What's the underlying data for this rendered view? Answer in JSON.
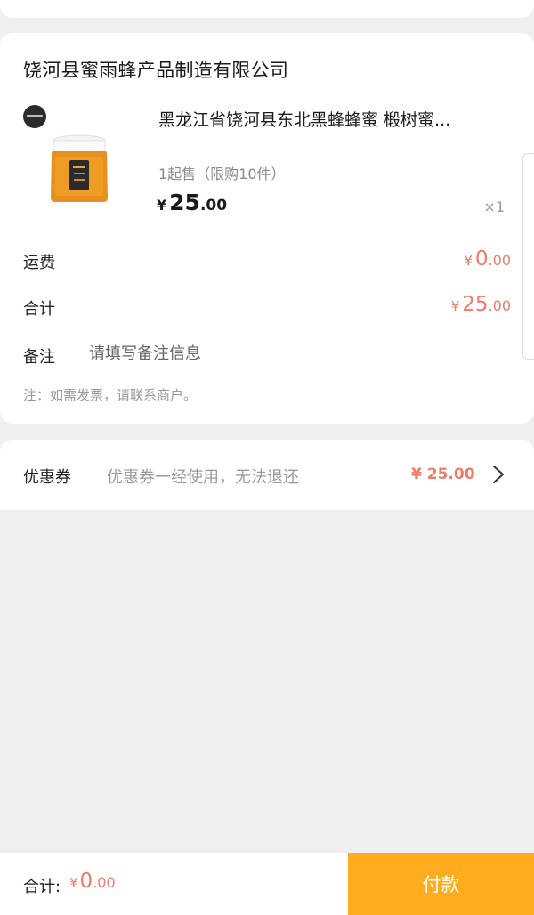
{
  "order": {
    "shop_name": "饶河县蜜雨蜂产品制造有限公司",
    "product": {
      "title": "黑龙江省饶河县东北黑蜂蜂蜜 椴树蜜...",
      "sale_rule": "1起售（限购10件）",
      "price_currency": "¥",
      "price_int": "25",
      "price_dec": ".00",
      "quantity": "×1",
      "image_icon": "honey-jar-image"
    },
    "shipping": {
      "label": "运费",
      "currency": "¥",
      "int": "0",
      "dec": ".00"
    },
    "subtotal": {
      "label": "合计",
      "currency": "¥",
      "int": "25",
      "dec": ".00"
    },
    "note": {
      "label": "备注",
      "placeholder": "请填写备注信息",
      "value": ""
    },
    "invoice_hint": "注：如需发票，请联系商户。"
  },
  "coupon": {
    "label": "优惠券",
    "description": "优惠券一经使用，无法退还",
    "amount": "¥ 25.00",
    "icon": "chevron-right-icon"
  },
  "footer": {
    "total_label": "合计:",
    "total_currency": "¥",
    "total_int": "0",
    "total_dec": ".00",
    "pay_label": "付款"
  },
  "colors": {
    "accent_price": "#f07b6b",
    "pay_button": "#ffad1f",
    "background": "#efefef"
  }
}
